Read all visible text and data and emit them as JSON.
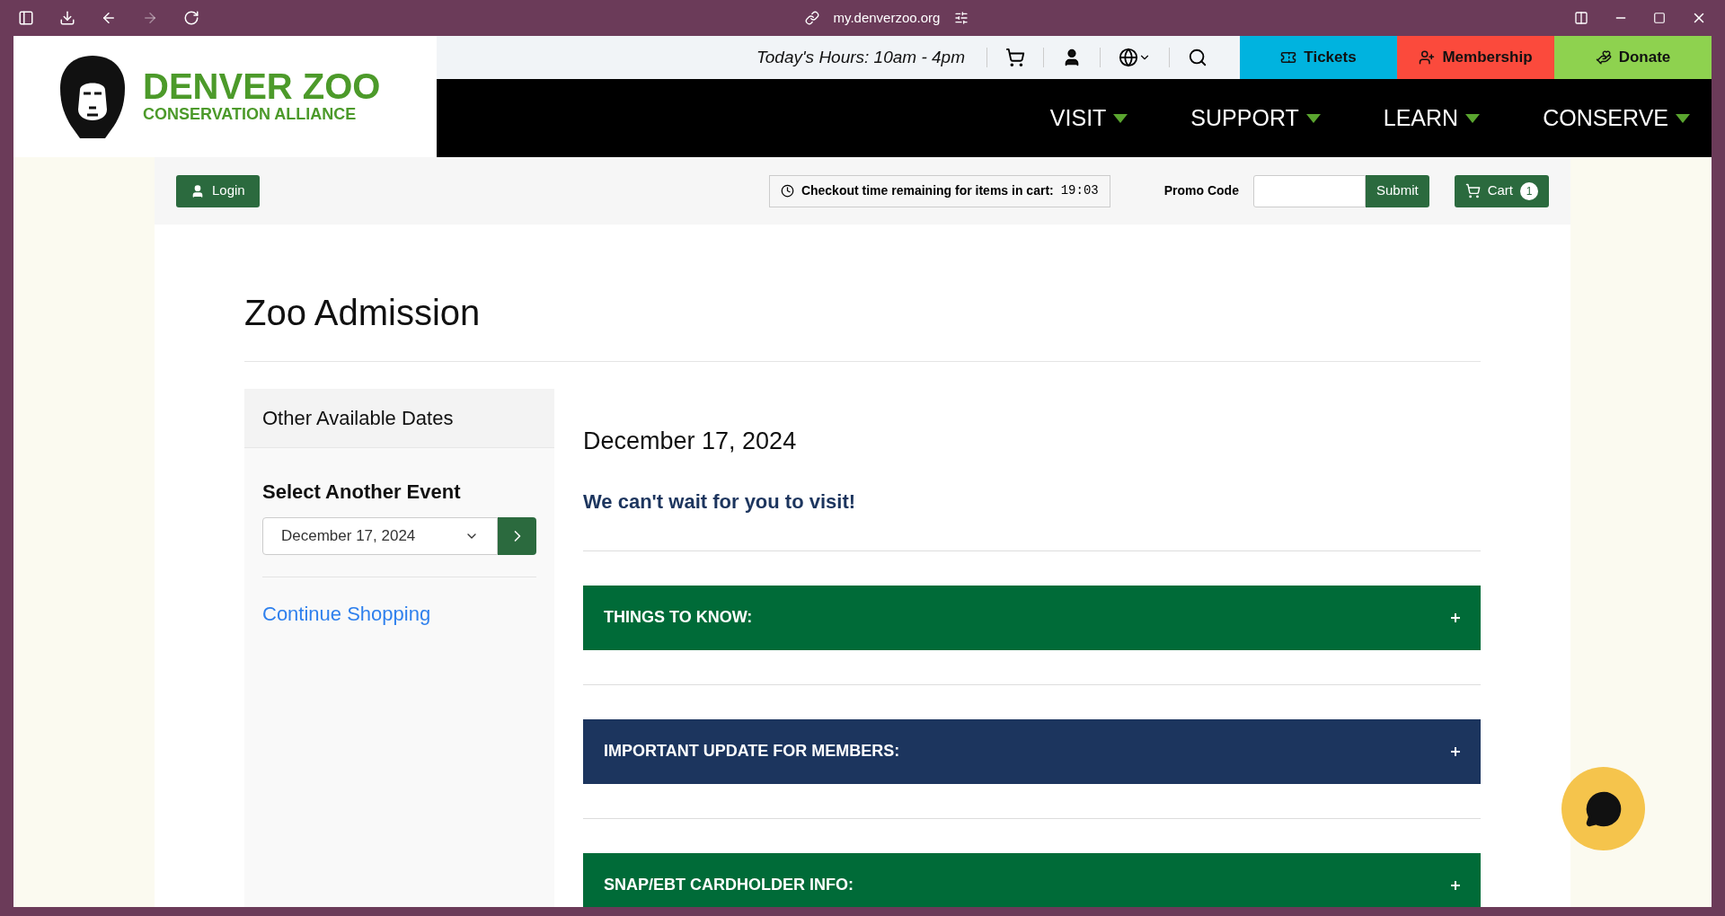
{
  "browser": {
    "url": "my.denverzoo.org"
  },
  "logo": {
    "title": "DENVER ZOO",
    "subtitle": "CONSERVATION ALLIANCE"
  },
  "utility_bar": {
    "hours": "Today's Hours: 10am - 4pm",
    "actions": [
      {
        "label": "Tickets",
        "kind": "tickets",
        "color": "#00b3df"
      },
      {
        "label": "Membership",
        "kind": "membership",
        "color": "#fb4a3c"
      },
      {
        "label": "Donate",
        "kind": "donate",
        "color": "#8ed24f"
      }
    ]
  },
  "nav": [
    "VISIT",
    "SUPPORT",
    "LEARN",
    "CONSERVE"
  ],
  "toolbar": {
    "login": "Login",
    "timer_label": "Checkout time remaining for items in cart:",
    "timer": "19:03",
    "promo_label": "Promo Code",
    "submit": "Submit",
    "cart": "Cart",
    "cart_count": "1"
  },
  "page_title": "Zoo Admission",
  "sidebar": {
    "heading": "Other Available Dates",
    "select_label": "Select Another Event",
    "select_value": "December 17, 2024",
    "link": "Continue Shopping"
  },
  "main": {
    "date": "December 17, 2024",
    "tagline": "We can't wait for you to visit!",
    "sections": [
      {
        "title": "THINGS TO KNOW:",
        "expanded": false,
        "color": "#006b38"
      },
      {
        "title": "IMPORTANT UPDATE FOR MEMBERS:",
        "expanded": false,
        "color": "#1c355e"
      },
      {
        "title": "SNAP/EBT CARDHOLDER INFO:",
        "expanded": false,
        "color": "#006b38"
      }
    ]
  }
}
